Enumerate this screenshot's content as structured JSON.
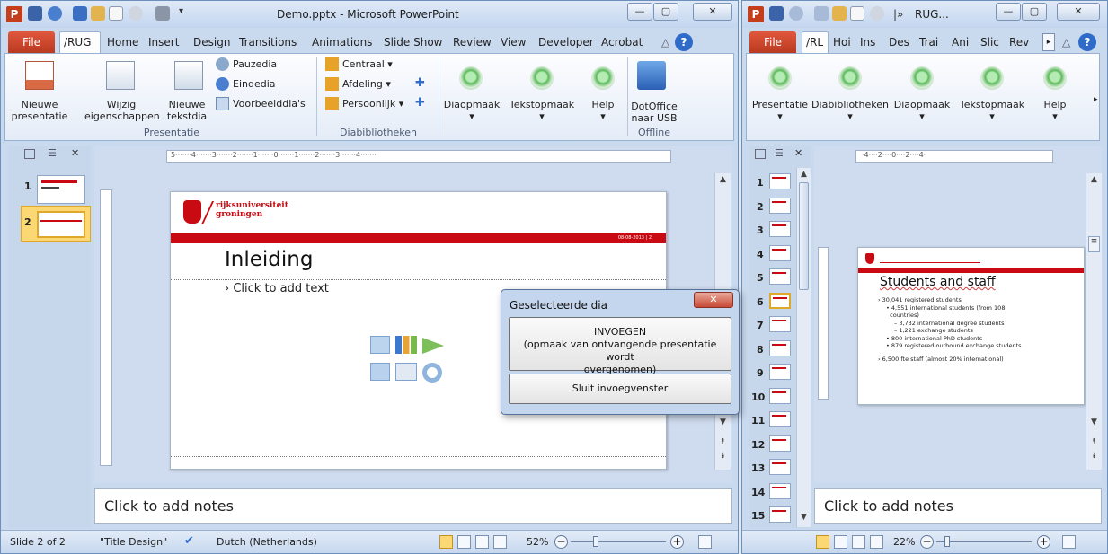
{
  "window1": {
    "title": "Demo.pptx - Microsoft PowerPoint",
    "app_icon": "P",
    "tabs": [
      "File",
      "/RUG",
      "Home",
      "Insert",
      "Design",
      "Transitions",
      "Animations",
      "Slide Show",
      "Review",
      "View",
      "Developer",
      "Acrobat"
    ],
    "help_icon": "?",
    "ribbon": {
      "nieuwe_presentatie": [
        "Nieuwe",
        "presentatie"
      ],
      "wijzig": [
        "Wijzig",
        "eigenschappen"
      ],
      "nieuwe_tekstdia": [
        "Nieuwe",
        "tekstdia"
      ],
      "pauzedia": "Pauzedia",
      "eindedia": "Eindedia",
      "voorbeelddias": "Voorbeelddia's",
      "group_presentatie": "Presentatie",
      "centraal": "Centraal",
      "afdeling": "Afdeling",
      "persoonlijk": "Persoonlijk",
      "group_diabibliotheken": "Diabibliotheken",
      "diaopmaak": "Diaopmaak",
      "tekstopmaak": "Tekstopmaak",
      "help": "Help",
      "dotoffice": [
        "DotOffice",
        "naar USB"
      ],
      "group_offline": "Offline"
    },
    "ruler_h": "5·······4·······3·······2·······1·······0·······1·······2·······3·······4·······",
    "thumbs": [
      {
        "n": "1"
      },
      {
        "n": "2"
      }
    ],
    "slide": {
      "logo_line1": "rijksuniversiteit",
      "logo_line2": "groningen",
      "date": "08-08-2013",
      "page": "2",
      "title": "Inleiding",
      "bullet": "Click to add text"
    },
    "notes": "Click to add notes",
    "status": {
      "slide": "Slide 2 of 2",
      "theme": "\"Title Design\"",
      "language": "Dutch (Netherlands)",
      "zoom": "52%",
      "zoom_level": 0.52
    }
  },
  "dialog": {
    "title": "Geselecteerde dia",
    "insert_line1": "INVOEGEN",
    "insert_line2": "(opmaak van ontvangende presentatie wordt",
    "insert_line3": "overgenomen)",
    "close_label": "Sluit invoegvenster"
  },
  "window2": {
    "title": "RUG...",
    "app_icon": "P",
    "tabs": [
      "File",
      "/RL",
      "Hoi",
      "Ins",
      "Des",
      "Trai",
      "Ani",
      "Slic",
      "Rev"
    ],
    "help_icon": "?",
    "ribbon": {
      "presentatie": "Presentatie",
      "diabibliotheken": "Diabibliotheken",
      "diaopmaak": "Diaopmaak",
      "tekstopmaak": "Tekstopmaak",
      "help": "Help"
    },
    "ruler_h": "·4····2····0····2····4·",
    "thumbs": [
      "1",
      "2",
      "3",
      "4",
      "5",
      "6",
      "7",
      "8",
      "9",
      "10",
      "11",
      "12",
      "13",
      "14",
      "15"
    ],
    "slide": {
      "title": "Students and staff",
      "bullets": [
        {
          "level": 0,
          "text": "30,041 registered students"
        },
        {
          "level": 1,
          "text": "4,551 international students (from 108"
        },
        {
          "level": 1,
          "text": "countries)"
        },
        {
          "level": 2,
          "text": "3,732 international degree students"
        },
        {
          "level": 2,
          "text": "1,221 exchange students"
        },
        {
          "level": 1,
          "text": "800 international PhD students"
        },
        {
          "level": 1,
          "text": "879 registered outbound exchange students"
        },
        {
          "level": 0,
          "text": "6,500 fte staff (almost 20% international)"
        }
      ]
    },
    "notes": "Click to add notes",
    "status": {
      "zoom": "22%",
      "zoom_level": 0.22
    }
  }
}
